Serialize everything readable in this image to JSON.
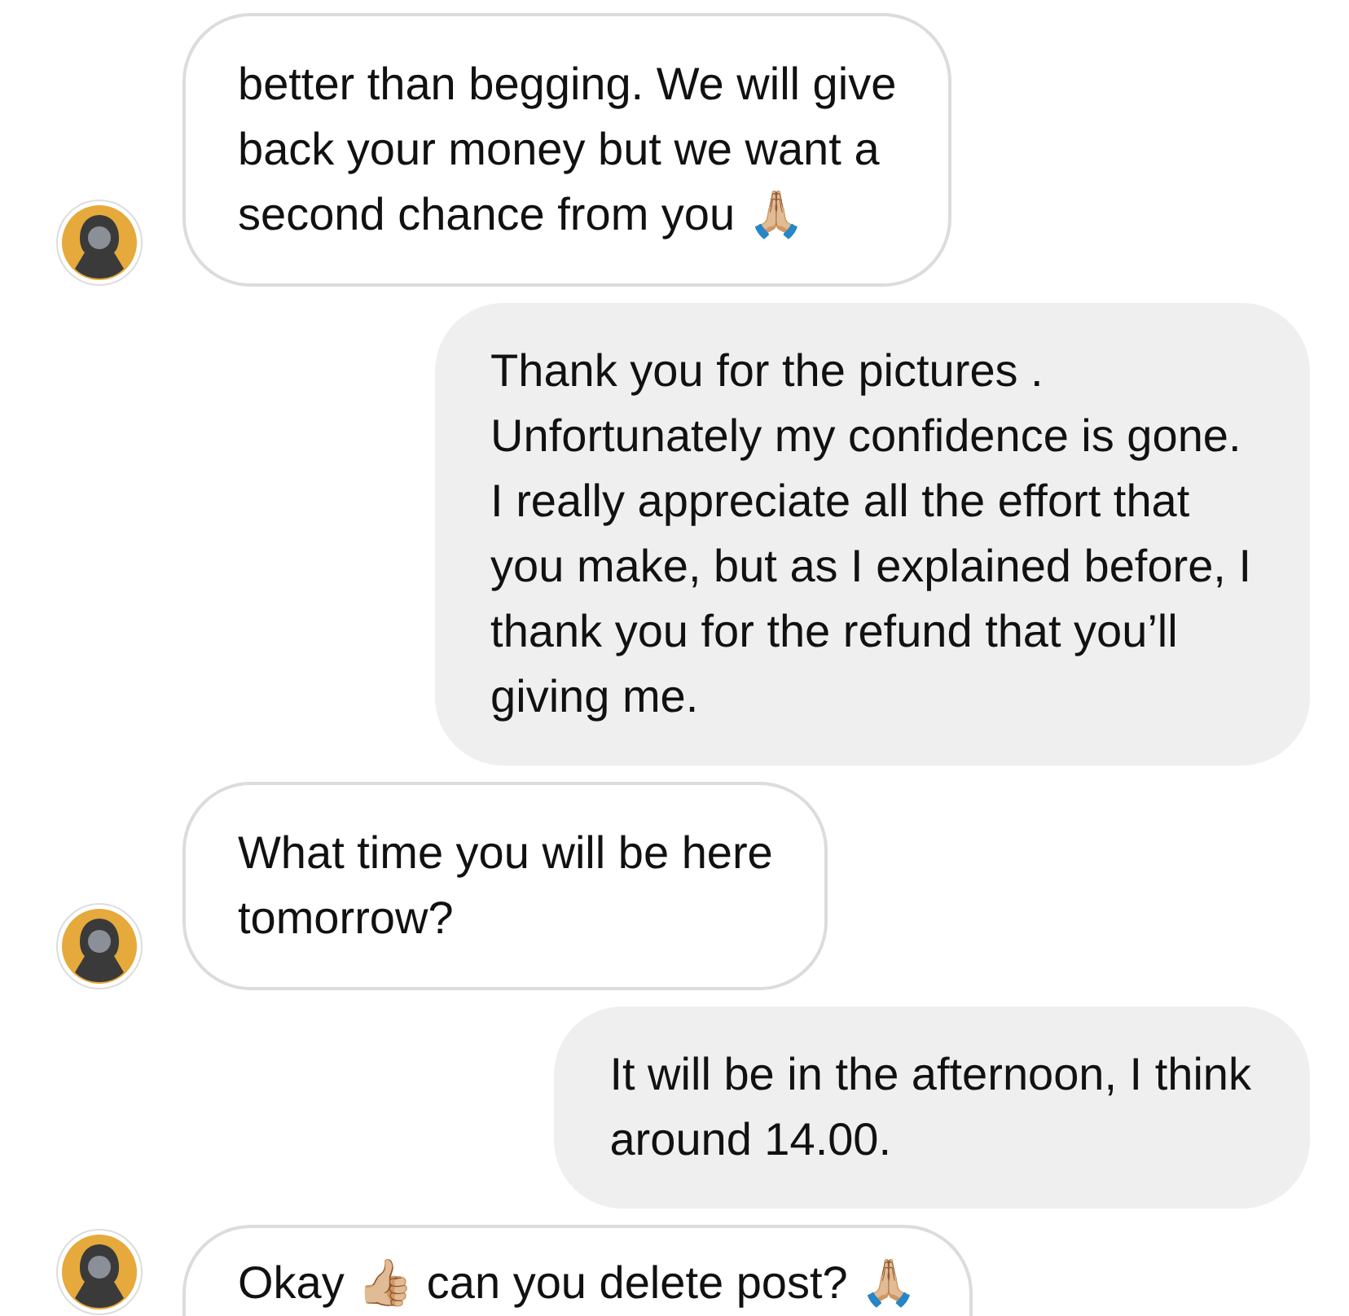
{
  "messages": [
    {
      "kind": "received",
      "text": "better than begging. We will give\nback your money but we want a\nsecond chance from you 🙏🏼"
    },
    {
      "kind": "sent",
      "text": "Thank you for the pictures .\nUnfortunately my confidence is gone.\nI really appreciate all the effort that\nyou make, but as I explained before, I\nthank you for the refund that you’ll\ngiving me."
    },
    {
      "kind": "received",
      "text": "What time you will be here\ntomorrow?"
    },
    {
      "kind": "sent",
      "text": "It will be in the afternoon, I think\naround 14.00."
    },
    {
      "kind": "received",
      "text": "Okay 👍🏼 can you delete post? 🙏🏼"
    }
  ]
}
